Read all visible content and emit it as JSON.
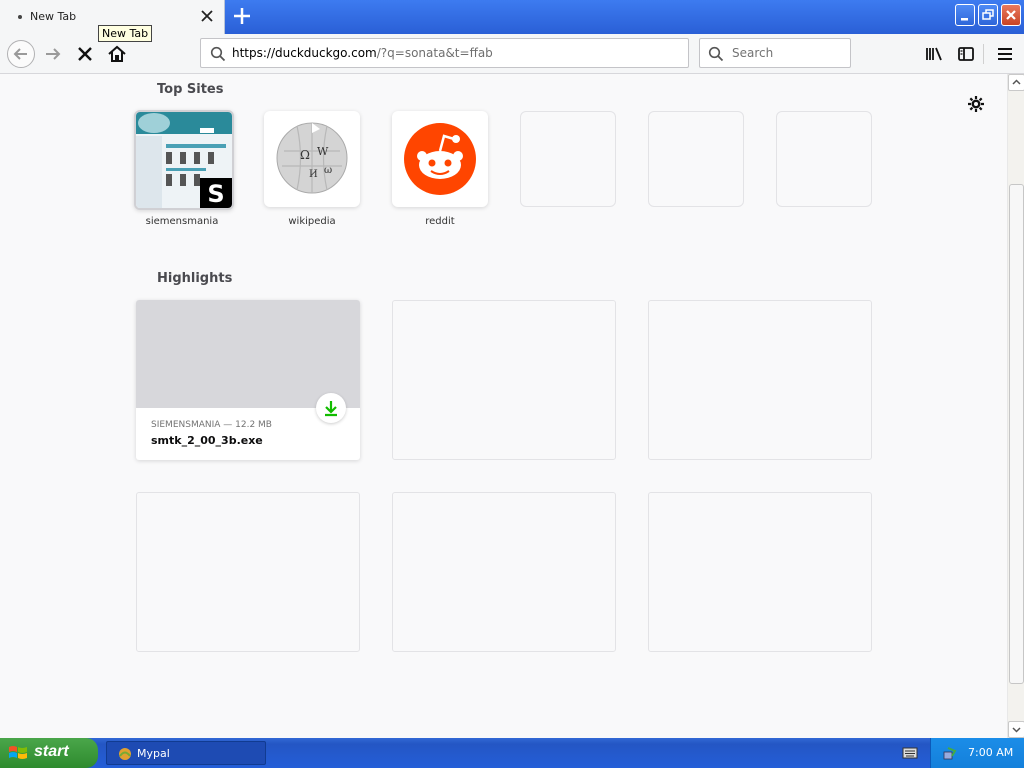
{
  "tab": {
    "title": "New Tab",
    "tooltip": "New Tab"
  },
  "toolbar": {
    "url_host": "https://duckduckgo.com",
    "url_rest": "/?q=sonata&t=ffab",
    "search_placeholder": "Search"
  },
  "newtab": {
    "top_sites_title": "Top Sites",
    "top_sites": [
      {
        "label": "siemensmania"
      },
      {
        "label": "wikipedia"
      },
      {
        "label": "reddit"
      }
    ],
    "highlights_title": "Highlights",
    "highlight": {
      "meta": "SIEMENSMANIA — 12.2 MB",
      "title": "smtk_2_00_3b.exe"
    }
  },
  "taskbar": {
    "start_label": "start",
    "task_label": "Mypal",
    "clock": "7:00 AM"
  },
  "colors": {
    "accent": "#2a5fd6",
    "reddit": "#ff4500",
    "download": "#12bc00"
  }
}
